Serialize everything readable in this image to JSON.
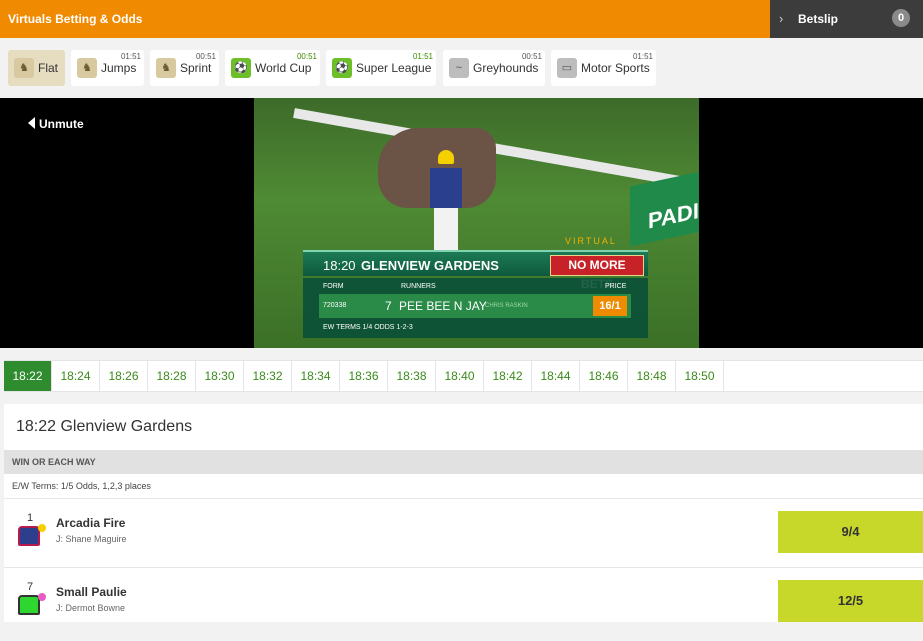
{
  "header": {
    "title": "Virtuals Betting & Odds",
    "betslip_label": "Betslip",
    "betslip_count": "0"
  },
  "categories": [
    {
      "label": "Flat",
      "time": "",
      "icon": "horse-racing-icon"
    },
    {
      "label": "Jumps",
      "time": "01:51",
      "icon": "horse-jumps-icon"
    },
    {
      "label": "Sprint",
      "time": "00:51",
      "icon": "horse-sprint-icon"
    },
    {
      "label": "World Cup",
      "time": "00:51",
      "icon": "football-icon"
    },
    {
      "label": "Super League",
      "time": "01:51",
      "icon": "football-icon"
    },
    {
      "label": "Greyhounds",
      "time": "00:51",
      "icon": "greyhound-icon"
    },
    {
      "label": "Motor Sports",
      "time": "01:51",
      "icon": "motor-sports-icon"
    }
  ],
  "video": {
    "unmute_label": "Unmute",
    "overlay": {
      "time": "18:20",
      "venue": "GLENVIEW GARDENS",
      "virtual_label": "VIRTUAL",
      "status": "NO MORE BETS",
      "col_form": "FORM",
      "col_runners": "RUNNERS",
      "col_price": "PRICE",
      "form": "720338",
      "number": "7",
      "runner": "PEE BEE N JAY",
      "jockey": "CHRIS RASKIN",
      "price": "16/1",
      "terms": "EW TERMS 1/4 ODDS 1-2-3"
    },
    "sign_text": "PADI"
  },
  "race_times": [
    "18:22",
    "18:24",
    "18:26",
    "18:28",
    "18:30",
    "18:32",
    "18:34",
    "18:36",
    "18:38",
    "18:40",
    "18:42",
    "18:44",
    "18:46",
    "18:48",
    "18:50"
  ],
  "event": {
    "title": "18:22 Glenview Gardens",
    "market": "WIN OR EACH WAY",
    "terms": "E/W Terms: 1/5 Odds, 1,2,3 places",
    "runners": [
      {
        "number": "1",
        "name": "Arcadia Fire",
        "jockey": "J: Shane Maguire",
        "price": "9/4"
      },
      {
        "number": "7",
        "name": "Small Paulie",
        "jockey": "J: Dermot Bowne",
        "price": "12/5"
      }
    ]
  },
  "colors": {
    "header_orange": "#f08a00",
    "active_green": "#2e8b2e",
    "price_lime": "#c7d82a"
  }
}
